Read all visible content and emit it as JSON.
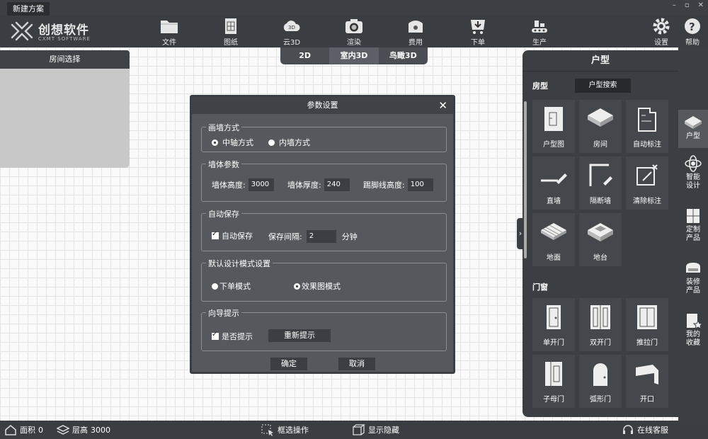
{
  "window": {
    "title": "新建方案",
    "min": "–",
    "max": "▫",
    "close": "✕"
  },
  "logo": {
    "cn": "创想软件",
    "en": "CXMT SOFTWARE"
  },
  "toolbar": [
    {
      "label": "文件",
      "icon": "folder-icon"
    },
    {
      "label": "图纸",
      "icon": "drawing-icon"
    },
    {
      "label": "云3D",
      "icon": "cloud-3d-icon"
    },
    {
      "label": "渲染",
      "icon": "camera-icon"
    },
    {
      "label": "费用",
      "icon": "wallet-icon"
    },
    {
      "label": "下单",
      "icon": "cart-icon"
    },
    {
      "label": "生产",
      "icon": "factory-icon"
    },
    {
      "label": "设置",
      "icon": "gear-icon"
    },
    {
      "label": "帮助",
      "icon": "help-icon"
    }
  ],
  "view_tabs": [
    {
      "label": "2D"
    },
    {
      "label": "室内3D",
      "active": true
    },
    {
      "label": "鸟瞰3D"
    }
  ],
  "room_panel": {
    "title": "房间选择"
  },
  "dialog": {
    "title": "参数设置",
    "close": "✕",
    "wall_mode": {
      "title": "画墙方式",
      "opt1": "中轴方式",
      "opt2": "内墙方式",
      "selected": "中轴方式"
    },
    "wall_params": {
      "title": "墙体参数",
      "height_label": "墙体高度:",
      "height_value": "3000",
      "thickness_label": "墙体厚度:",
      "thickness_value": "240",
      "baseboard_label": "踢脚线高度:",
      "baseboard_value": "100"
    },
    "autosave": {
      "title": "自动保存",
      "enable_label": "自动保存",
      "enabled": true,
      "interval_label": "保存间隔:",
      "interval_value": "2",
      "unit": "分钟"
    },
    "design_mode": {
      "title": "默认设计模式设置",
      "opt1": "下单模式",
      "opt2": "效果图模式",
      "selected": "效果图模式"
    },
    "guide": {
      "title": "向导提示",
      "enable_label": "是否提示",
      "enabled": true,
      "reset_button": "重新提示"
    },
    "ok": "确定",
    "cancel": "取消"
  },
  "right_panel": {
    "title": "户型",
    "section1": "房型",
    "search_button": "户型搜索",
    "items": [
      {
        "label": "户型图",
        "icon": "floorplan-icon"
      },
      {
        "label": "房间",
        "icon": "room-icon"
      },
      {
        "label": "自动标注",
        "icon": "auto-dimension-icon"
      },
      {
        "label": "直墙",
        "icon": "straight-wall-icon"
      },
      {
        "label": "隔断墙",
        "icon": "partition-wall-icon"
      },
      {
        "label": "清除标注",
        "icon": "clear-dimension-icon"
      },
      {
        "label": "地面",
        "icon": "floor-icon"
      },
      {
        "label": "地台",
        "icon": "platform-icon"
      }
    ],
    "section2": "门窗",
    "doors": [
      {
        "label": "单开门",
        "icon": "single-door-icon"
      },
      {
        "label": "双开门",
        "icon": "double-door-icon"
      },
      {
        "label": "推拉门",
        "icon": "sliding-door-icon"
      },
      {
        "label": "子母门",
        "icon": "mother-child-door-icon"
      },
      {
        "label": "弧形门",
        "icon": "arch-door-icon"
      },
      {
        "label": "开口",
        "icon": "opening-icon"
      }
    ],
    "collapse": "›"
  },
  "sidebar": [
    {
      "label": "户型",
      "icon": "house-type-icon",
      "active": true
    },
    {
      "label": "智能设计",
      "line1": "智能",
      "line2": "设计",
      "icon": "ai-design-icon"
    },
    {
      "label": "定制产品",
      "line1": "定制",
      "line2": "产品",
      "icon": "custom-product-icon"
    },
    {
      "label": "装修产品",
      "line1": "装修",
      "line2": "产品",
      "icon": "decor-product-icon"
    },
    {
      "label": "我的收藏",
      "line1": "我的",
      "line2": "收藏",
      "icon": "favorites-icon"
    }
  ],
  "status": {
    "area_label": "面积",
    "area_value": "0",
    "floor_label": "层高",
    "floor_value": "3000",
    "select_op": "框选操作",
    "show_hide": "显示隐藏",
    "support": "在线客服"
  }
}
